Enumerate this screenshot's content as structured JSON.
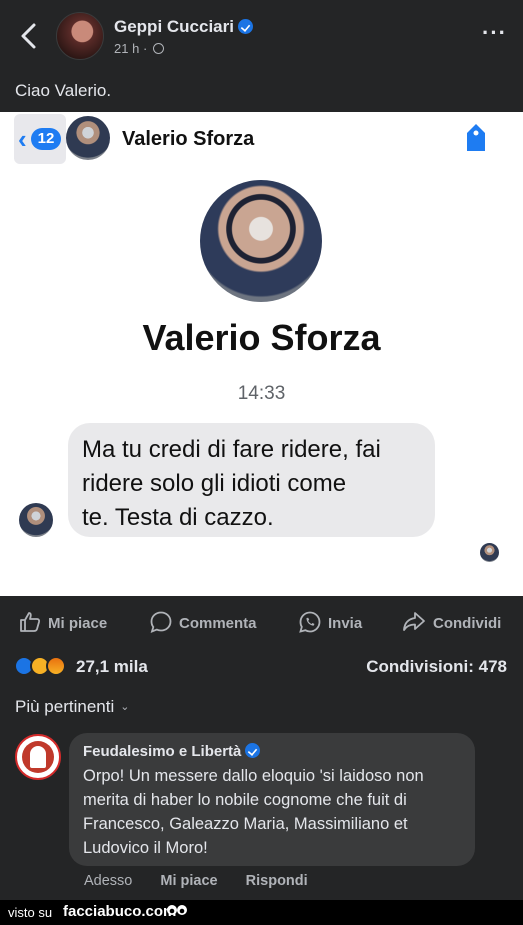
{
  "header": {
    "author": "Geppi Cucciari",
    "time": "21 h",
    "meta_separator": "·"
  },
  "post": {
    "text": "Ciao Valerio."
  },
  "screenshot": {
    "back_count": "12",
    "contact_name": "Valerio Sforza",
    "time": "14:33",
    "message_lines": [
      "Ma tu credi di fare ridere, fai",
      "ridere solo gli idioti come",
      "te. Testa di cazzo."
    ]
  },
  "actions": {
    "like": "Mi piace",
    "comment": "Commenta",
    "send": "Invia",
    "share": "Condividi"
  },
  "stats": {
    "reactions_count": "27,1 mila",
    "shares": "Condivisioni: 478"
  },
  "filter": {
    "label": "Più pertinenti"
  },
  "comment": {
    "author": "Feudalesimo e Libertà",
    "text": "Orpo! Un messere dallo eloquio 'si laidoso non merita di haber lo nobile cognome che fuit di Francesco, Galeazzo Maria, Massimiliano et Ludovico il Moro!",
    "time": "Adesso",
    "like": "Mi piace",
    "reply": "Rispondi"
  },
  "watermark": {
    "prefix": "visto su",
    "site": "facciabuco.com"
  },
  "colors": {
    "background": "#242526",
    "accent": "#1b74e4",
    "ios_blue": "#1e7cf2",
    "bubble_gray": "#e9e9eb",
    "comment_bubble": "#3a3b3c"
  },
  "icons": [
    "back-chevron-icon",
    "verified-icon",
    "globe-icon",
    "more-icon",
    "tag-icon",
    "like-icon",
    "comment-icon",
    "whatsapp-icon",
    "share-icon"
  ]
}
